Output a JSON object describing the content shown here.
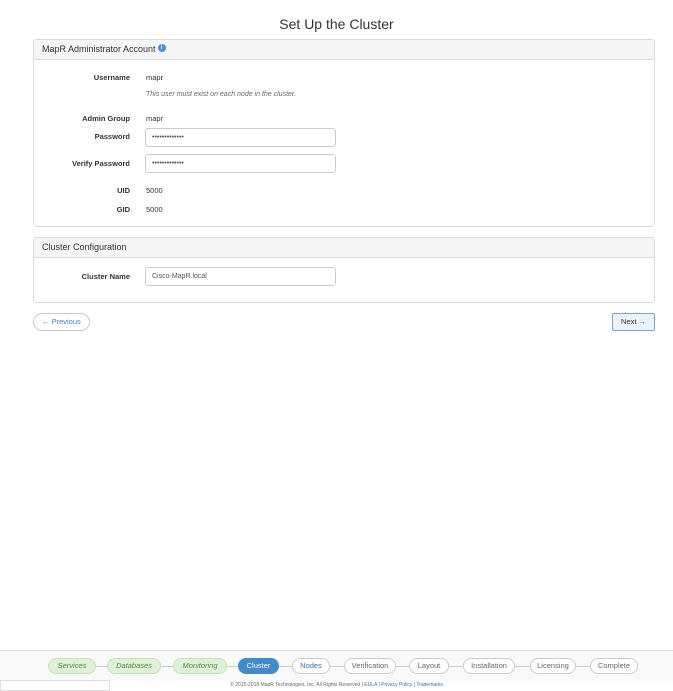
{
  "page": {
    "title": "Set Up the Cluster"
  },
  "admin_panel": {
    "heading": "MapR Administrator Account",
    "username_label": "Username",
    "username_value": "mapr",
    "username_help": "This user must exist on each node in the cluster.",
    "admin_group_label": "Admin Group",
    "admin_group_value": "mapr",
    "password_label": "Password",
    "password_value": "•••••••••••••",
    "verify_label": "Verify Password",
    "verify_value": "•••••••••••••",
    "uid_label": "UID",
    "uid_value": "5000",
    "gid_label": "GID",
    "gid_value": "5000"
  },
  "cluster_panel": {
    "heading": "Cluster Configuration",
    "name_label": "Cluster Name",
    "name_value": "Cisco-MapR.local"
  },
  "nav": {
    "previous_label": "← Previous",
    "next_label": "Next →"
  },
  "wizard": {
    "steps": [
      {
        "label": "Services",
        "state": "done"
      },
      {
        "label": "Databases",
        "state": "done"
      },
      {
        "label": "Monitoring",
        "state": "done"
      },
      {
        "label": "Cluster",
        "state": "active"
      },
      {
        "label": "Nodes",
        "state": "next"
      },
      {
        "label": "Verification",
        "state": "pending"
      },
      {
        "label": "Layout",
        "state": "pending"
      },
      {
        "label": "Installation",
        "state": "pending"
      },
      {
        "label": "Licensing",
        "state": "pending"
      },
      {
        "label": "Complete",
        "state": "pending"
      }
    ]
  },
  "footer": {
    "copyright": "© 2015-2018 MapR Technologies, Inc. All Rights Reserved |",
    "eula": "EULA",
    "privacy": "Privacy Policy",
    "trademarks": "Trademarks",
    "sep": "|"
  }
}
